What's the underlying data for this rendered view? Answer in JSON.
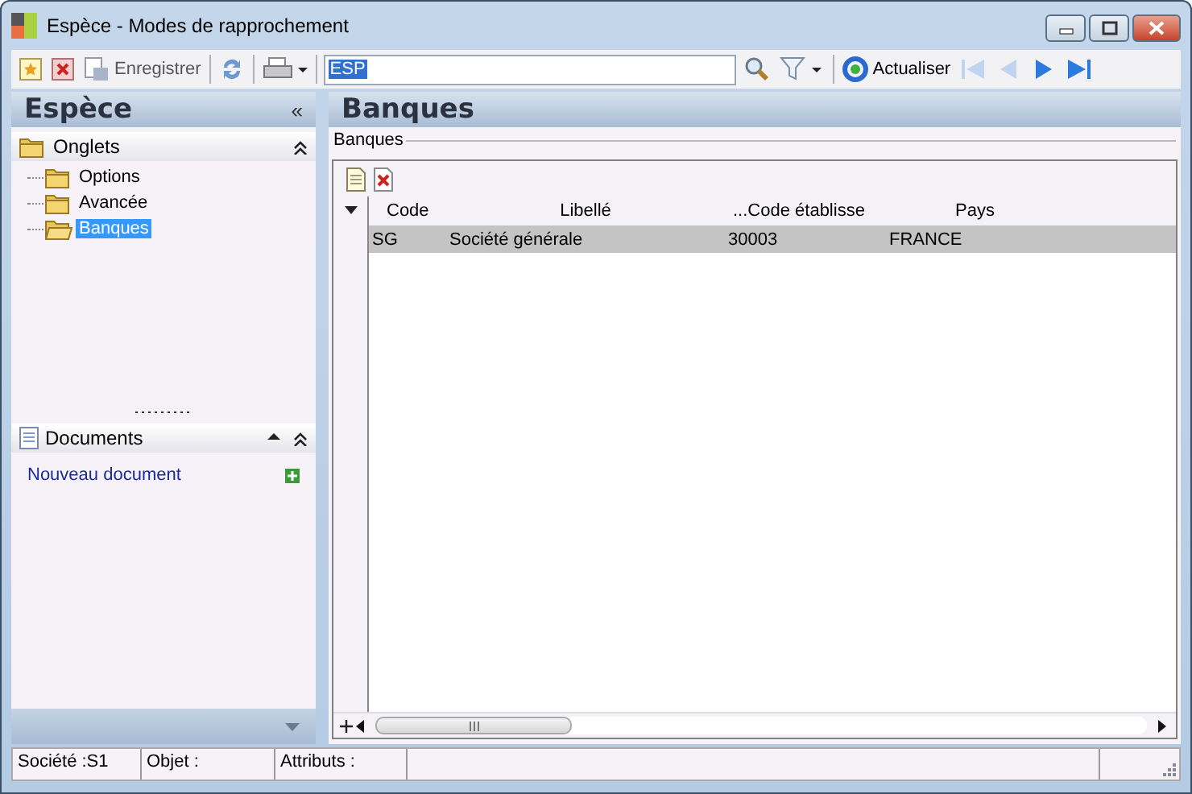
{
  "window": {
    "title": "Espèce -  Modes de rapprochement"
  },
  "toolbar": {
    "save_label": "Enregistrer",
    "save_disabled": true,
    "search": {
      "value": "ESP",
      "text_selected": true
    },
    "refresh_label": "Actualiser",
    "nav": [
      {
        "kind": "first",
        "disabled": true
      },
      {
        "kind": "prev",
        "disabled": true
      },
      {
        "kind": "next",
        "disabled": false
      },
      {
        "kind": "last",
        "disabled": false
      }
    ]
  },
  "sidebar": {
    "title": "Espèce",
    "collapse": "«",
    "sections": [
      {
        "title": "Onglets",
        "kind": "tree",
        "items": [
          {
            "label": "Options",
            "selected": false
          },
          {
            "label": "Avancée",
            "selected": false
          },
          {
            "label": "Banques",
            "selected": true
          }
        ]
      },
      {
        "title": "Documents",
        "kind": "links",
        "items": [
          {
            "label": "Nouveau document"
          }
        ]
      }
    ]
  },
  "main": {
    "title": "Banques",
    "group_label": "Banques",
    "table": {
      "columns": [
        "Code",
        "Libellé",
        "...Code établisse",
        "Pays"
      ],
      "rows": [
        {
          "cells": [
            "SG",
            "Société générale",
            "30003",
            "FRANCE"
          ],
          "selected": true
        }
      ]
    }
  },
  "status_bar": [
    "Société :S1",
    "Objet :",
    "Attributs :"
  ]
}
